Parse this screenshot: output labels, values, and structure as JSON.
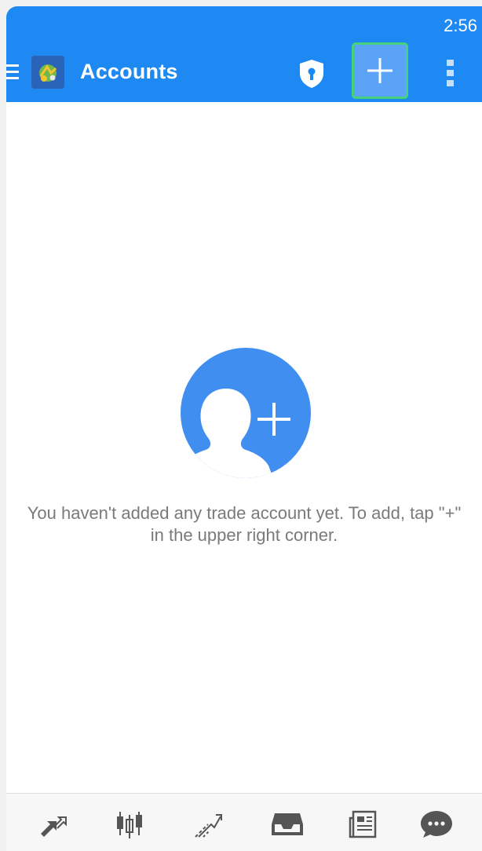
{
  "status_bar": {
    "time": "2:56"
  },
  "app_bar": {
    "title": "Accounts",
    "icons": {
      "menu": "hamburger-menu-icon",
      "logo": "metatrader-logo",
      "shield": "shield-keyhole-icon",
      "add": "plus-icon",
      "more": "vertical-dots-icon"
    },
    "accent_color": "#1e88f3",
    "highlight_color": "#47d17c"
  },
  "empty_state": {
    "icon": "add-person-icon",
    "message": "You haven't added any trade account yet. To add, tap \"+\" in the upper right corner."
  },
  "bottom_nav": {
    "items": [
      {
        "icon": "quotes-arrows-icon"
      },
      {
        "icon": "chart-candles-icon"
      },
      {
        "icon": "trade-lines-icon"
      },
      {
        "icon": "history-inbox-icon"
      },
      {
        "icon": "news-icon"
      },
      {
        "icon": "chat-bubble-icon"
      }
    ]
  }
}
